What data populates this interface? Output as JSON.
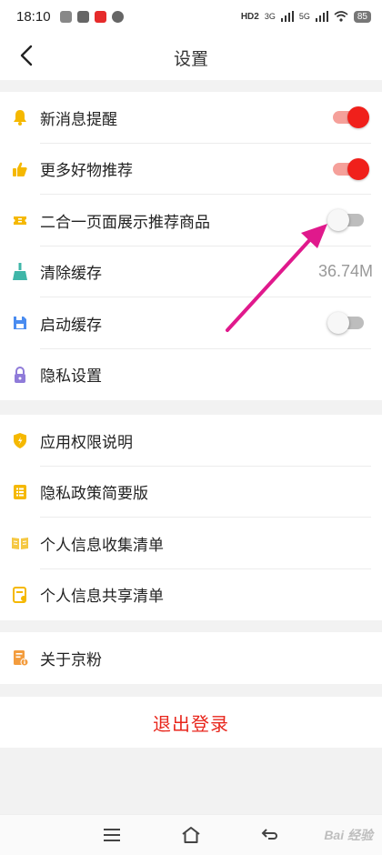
{
  "status_bar": {
    "time": "18:10",
    "network_hd": "HD2",
    "network_3g": "3G",
    "network_5g": "5G",
    "battery": "85"
  },
  "header": {
    "title": "设置"
  },
  "section1": {
    "items": [
      {
        "label": "新消息提醒",
        "icon": "bell-icon",
        "toggle": true
      },
      {
        "label": "更多好物推荐",
        "icon": "thumbs-up-icon",
        "toggle": true
      },
      {
        "label": "二合一页面展示推荐商品",
        "icon": "ticket-icon",
        "toggle": false
      },
      {
        "label": "清除缓存",
        "icon": "broom-icon",
        "value": "36.74M"
      },
      {
        "label": "启动缓存",
        "icon": "save-icon",
        "toggle": false
      },
      {
        "label": "隐私设置",
        "icon": "lock-icon"
      }
    ]
  },
  "section2": {
    "items": [
      {
        "label": "应用权限说明",
        "icon": "shield-icon"
      },
      {
        "label": "隐私政策简要版",
        "icon": "list-icon"
      },
      {
        "label": "个人信息收集清单",
        "icon": "book-icon"
      },
      {
        "label": "个人信息共享清单",
        "icon": "share-doc-icon"
      }
    ]
  },
  "section3": {
    "items": [
      {
        "label": "关于京粉",
        "icon": "info-doc-icon"
      }
    ]
  },
  "logout": {
    "label": "退出登录"
  },
  "watermark": "Bai 经验",
  "colors": {
    "accent_red": "#f0201b",
    "toggle_on_track": "#f5a09a",
    "icon_yellow": "#f5b800",
    "icon_blue": "#4a8cf0",
    "icon_purple": "#8f7bd9",
    "annotation_arrow": "#e0198c"
  }
}
